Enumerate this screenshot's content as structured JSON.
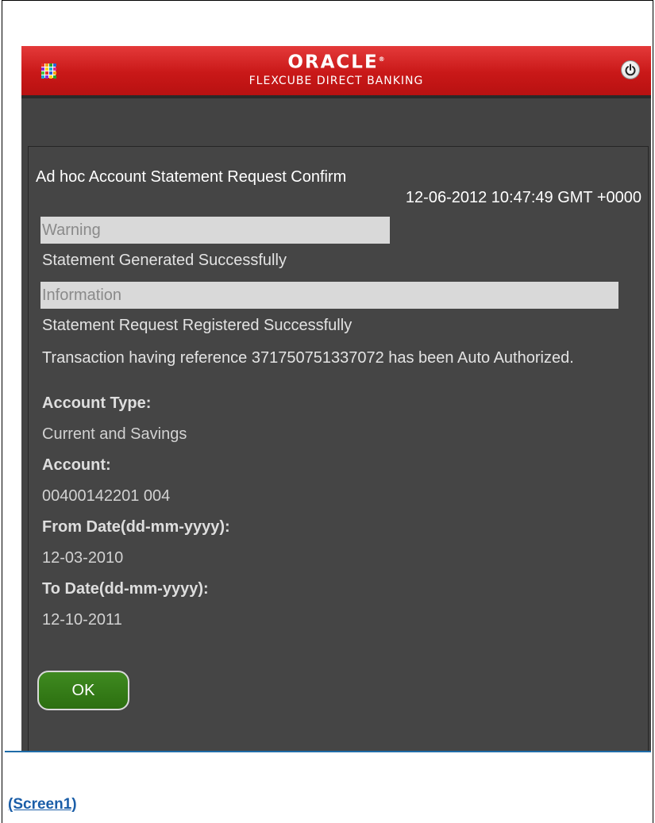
{
  "header": {
    "brand": "ORACLE",
    "brand_mark": "®",
    "subtitle": "FLEXCUBE DIRECT BANKING",
    "menu_icon": "grid-menu-icon",
    "logout_icon": "power-icon",
    "menu_colors": [
      "#e6322b",
      "#f6a21a",
      "#2aa52a",
      "#2b63d6",
      "#8b2bd6",
      "#ffd21a",
      "#1aa9d6",
      "#d62b8b",
      "#47c247",
      "#e6322b",
      "#2b63d6",
      "#f6a21a",
      "#1aa9d6",
      "#8b2bd6",
      "#ffd21a",
      "#2aa52a"
    ]
  },
  "confirmation": {
    "title": "Ad hoc Account Statement Request Confirm",
    "timestamp": "12-06-2012 10:47:49 GMT +0000",
    "warning_label": "Warning",
    "warning_message": "Statement Generated Successfully",
    "information_label": "Information",
    "information_message": "Statement Request Registered Successfully",
    "reference_message": "Transaction having reference 371750751337072 has been Auto Authorized."
  },
  "fields": [
    {
      "label": "Account Type:",
      "value": "Current and Savings"
    },
    {
      "label": "Account:",
      "value": "00400142201 004"
    },
    {
      "label": "From Date(dd-mm-yyyy):",
      "value": "12-03-2010"
    },
    {
      "label": "To Date(dd-mm-yyyy):",
      "value": "12-10-2011"
    }
  ],
  "actions": {
    "ok_label": "OK"
  },
  "caption": "(Screen1)",
  "colors": {
    "header_red": "#c91818",
    "background": "#434343",
    "ok_green": "#2c6f10",
    "caption_blue": "#1b5ea8"
  }
}
